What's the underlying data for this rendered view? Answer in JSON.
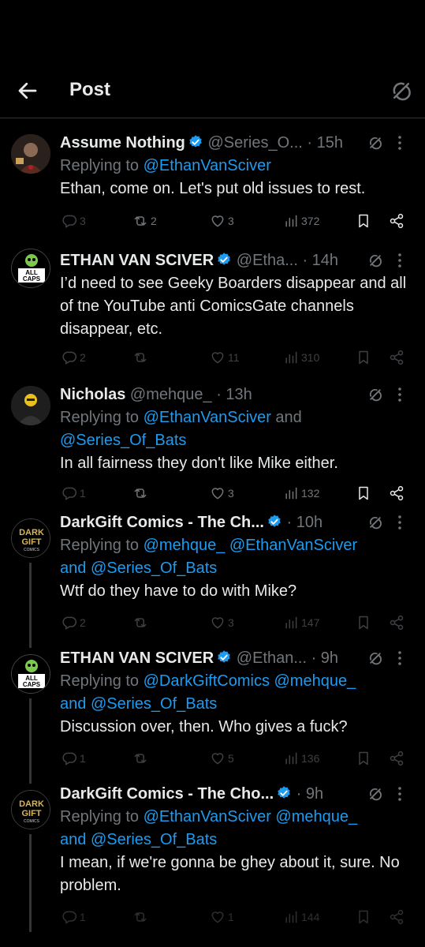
{
  "header": {
    "title": "Post"
  },
  "tweets": [
    {
      "name": "Assume Nothing",
      "handle": "@Series_O...",
      "time": "· 15h",
      "replying_prefix": "Replying to ",
      "replying_line1": "@EthanVanSciver",
      "replying_mid": "",
      "replying_line2": "",
      "text": "Ethan, come on. Let's put old issues to rest.",
      "replies": "3",
      "retweets": "2",
      "likes": "3",
      "views": "372"
    },
    {
      "name": "ETHAN VAN SCIVER",
      "handle": "@Etha...",
      "time": "· 14h",
      "text": "I’d need to see Geeky Boarders disappear and all of tne YouTube anti ComicsGate channels disappear, etc.",
      "replies": "2",
      "retweets": "",
      "likes": "11",
      "views": "310"
    },
    {
      "name": "Nicholas",
      "handle": "@mehque_",
      "time": "· 13h",
      "replying_prefix": "Replying to ",
      "replying_line1": "@EthanVanSciver",
      "replying_mid": " and",
      "replying_line2": "@Series_Of_Bats",
      "text": "In all fairness they don't like Mike either.",
      "replies": "1",
      "retweets": "",
      "likes": "3",
      "views": "132"
    },
    {
      "name": "DarkGift Comics - The Ch...",
      "handle": "",
      "time": "· 10h",
      "replying_prefix": "Replying to ",
      "replying_line1": "@mehque_ @EthanVanSciver",
      "replying_mid": "and ",
      "replying_line2": "@Series_Of_Bats",
      "text": "Wtf do they have to do with Mike?",
      "replies": "2",
      "retweets": "",
      "likes": "3",
      "views": "147"
    },
    {
      "name": "ETHAN VAN SCIVER",
      "handle": "@Ethan...",
      "time": "· 9h",
      "replying_prefix": "Replying to ",
      "replying_line1": "@DarkGiftComics @mehque_",
      "replying_mid": "and ",
      "replying_line2": "@Series_Of_Bats",
      "text": "Discussion over, then.  Who gives a fuck?",
      "replies": "1",
      "retweets": "",
      "likes": "5",
      "views": "136"
    },
    {
      "name": "DarkGift Comics - The Cho...",
      "handle": "",
      "time": "· 9h",
      "replying_prefix": "Replying to ",
      "replying_line1": "@EthanVanSciver @mehque_",
      "replying_mid": "and ",
      "replying_line2": "@Series_Of_Bats",
      "text": "I mean, if we're gonna be ghey about it, sure. No problem.",
      "replies": "1",
      "retweets": "",
      "likes": "1",
      "views": "144"
    }
  ],
  "avatars": {
    "all_caps_line1": "ALL",
    "all_caps_line2": "CAPS",
    "dark_gift_line1": "DARK",
    "dark_gift_line2": "GIFT",
    "dark_gift_line3": "COMICS"
  },
  "colors": {
    "accent": "#1d9bf0",
    "muted": "#71767b",
    "text": "#e7e9ea",
    "background": "#000000"
  }
}
